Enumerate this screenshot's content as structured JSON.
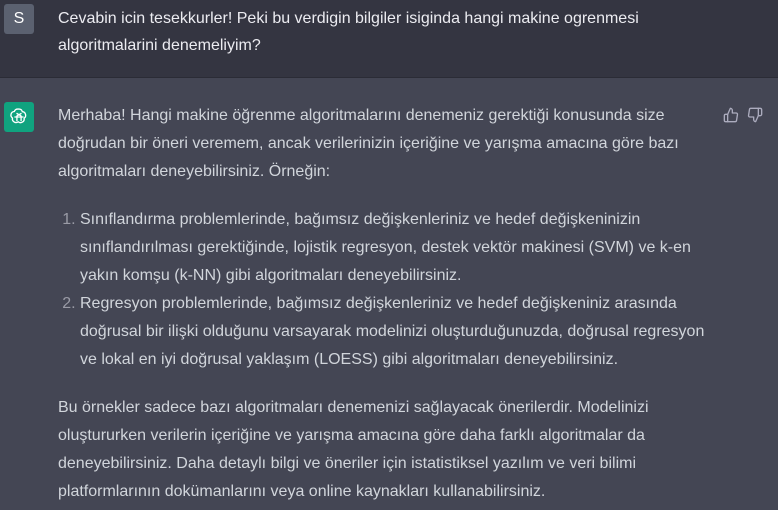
{
  "user_message": {
    "avatar_letter": "S",
    "text": "Cevabin icin tesekkurler! Peki bu verdigin bilgiler isiginda hangi makine ogrenmesi algoritmalarini denemeliyim?"
  },
  "assistant_message": {
    "avatar_icon": "openai-logo-icon",
    "intro": "Merhaba! Hangi makine öğrenme algoritmalarını denemeniz gerektiği konusunda size doğrudan bir öneri veremem, ancak verilerinizin içeriğine ve yarışma amacına göre bazı algoritmaları deneyebilirsiniz. Örneğin:",
    "list_items": [
      "Sınıflandırma problemlerinde, bağımsız değişkenleriniz ve hedef değişkeninizin sınıflandırılması gerektiğinde, lojistik regresyon, destek vektör makinesi (SVM) ve k-en yakın komşu (k-NN) gibi algoritmaları deneyebilirsiniz.",
      "Regresyon problemlerinde, bağımsız değişkenleriniz ve hedef değişkeniniz arasında doğrusal bir ilişki olduğunu varsayarak modelinizi oluşturduğunuzda, doğrusal regresyon ve lokal en iyi doğrusal yaklaşım (LOESS) gibi algoritmaları deneyebilirsiniz."
    ],
    "closing": "Bu örnekler sadece bazı algoritmaları denemenizi sağlayacak önerilerdir. Modelinizi oluştururken verilerin içeriğine ve yarışma amacına göre daha farklı algoritmalar da deneyebilirsiniz. Daha detaylı bilgi ve öneriler için istatistiksel yazılım ve veri bilimi platformlarının dokümanlarını veya online kaynakları kullanabilirsiniz."
  },
  "feedback": {
    "thumbs_up_icon": "thumbs-up-icon",
    "thumbs_down_icon": "thumbs-down-icon"
  },
  "colors": {
    "user_bg": "#343541",
    "assistant_bg": "#444654",
    "assistant_avatar": "#10a37f",
    "user_avatar": "#5b6170"
  }
}
